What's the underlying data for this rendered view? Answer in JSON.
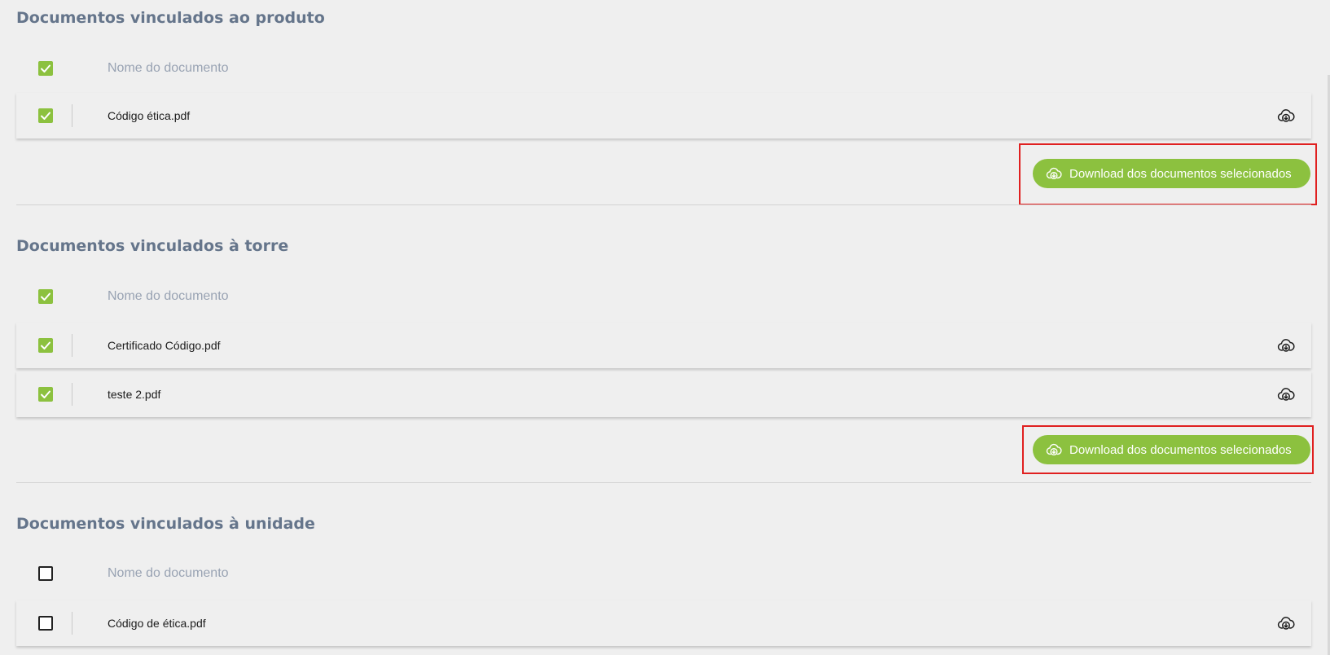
{
  "sections": [
    {
      "title": "Documentos vinculados ao produto",
      "header": {
        "label": "Nome do documento",
        "checked": true
      },
      "rows": [
        {
          "name": "Código ética.pdf",
          "checked": true
        }
      ],
      "download_button": {
        "label": "Download dos documentos selecionados"
      }
    },
    {
      "title": "Documentos vinculados à torre",
      "header": {
        "label": "Nome do documento",
        "checked": true
      },
      "rows": [
        {
          "name": "Certificado Código.pdf",
          "checked": true
        },
        {
          "name": "teste 2.pdf",
          "checked": true
        }
      ],
      "download_button": {
        "label": "Download dos documentos selecionados"
      }
    },
    {
      "title": "Documentos vinculados à unidade",
      "header": {
        "label": "Nome do documento",
        "checked": false
      },
      "rows": [
        {
          "name": "Código de ética.pdf",
          "checked": false
        }
      ]
    }
  ],
  "icons": {
    "checkbox_checked": "check-icon",
    "row_download": "cloud-download-icon",
    "button_download": "cloud-download-icon"
  },
  "colors": {
    "accent_green": "#8cc13f",
    "title_gray": "#65758b",
    "header_gray": "#99a3b3",
    "highlight_red": "#e02020",
    "background": "#efefef"
  }
}
